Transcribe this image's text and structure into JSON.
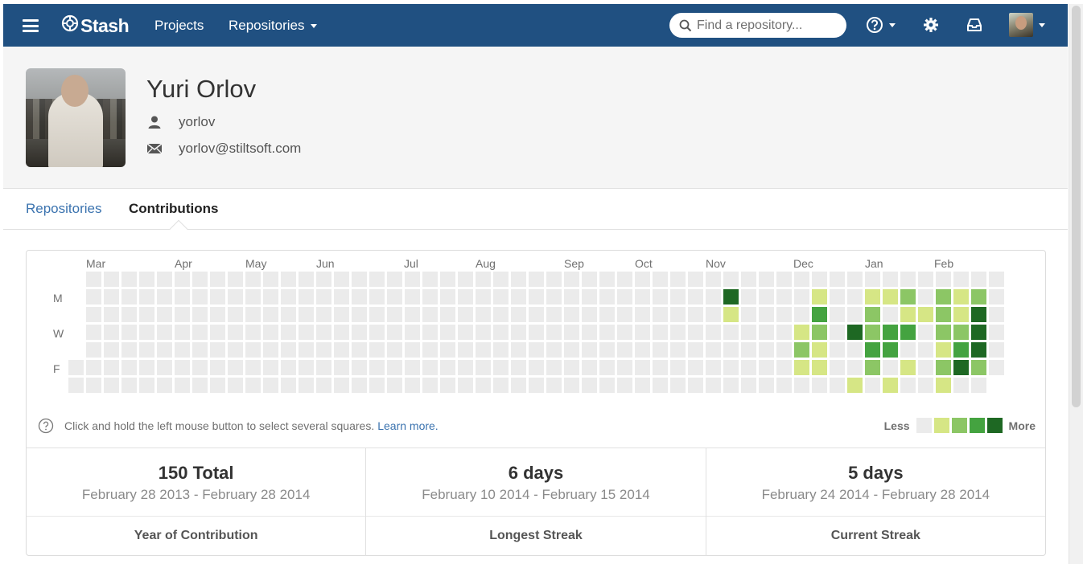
{
  "nav": {
    "logo_text": "Stash",
    "projects_label": "Projects",
    "repositories_label": "Repositories",
    "search_placeholder": "Find a repository...",
    "icons": [
      "menu-icon",
      "stash-logo-icon",
      "search-icon",
      "help-icon",
      "gear-icon",
      "inbox-icon",
      "user-avatar"
    ]
  },
  "profile": {
    "name": "Yuri Orlov",
    "username": "yorlov",
    "email": "yorlov@stiltsoft.com"
  },
  "tabs": [
    {
      "label": "Repositories",
      "active": false
    },
    {
      "label": "Contributions",
      "active": true
    }
  ],
  "calendar": {
    "months": [
      "Mar",
      "Apr",
      "May",
      "Jun",
      "Jul",
      "Aug",
      "Sep",
      "Oct",
      "Nov",
      "Dec",
      "Jan",
      "Feb"
    ],
    "day_labels": [
      "M",
      "W",
      "F"
    ],
    "levels": [
      "#ebebeb",
      "#d6e685",
      "#8cc665",
      "#44a340",
      "#1e6823"
    ],
    "active_cells": [
      {
        "week": 37,
        "day": 1,
        "level": 4
      },
      {
        "week": 37,
        "day": 2,
        "level": 1
      },
      {
        "week": 41,
        "day": 3,
        "level": 1
      },
      {
        "week": 41,
        "day": 4,
        "level": 2
      },
      {
        "week": 41,
        "day": 5,
        "level": 1
      },
      {
        "week": 42,
        "day": 1,
        "level": 1
      },
      {
        "week": 42,
        "day": 2,
        "level": 3
      },
      {
        "week": 42,
        "day": 3,
        "level": 2
      },
      {
        "week": 42,
        "day": 4,
        "level": 1
      },
      {
        "week": 42,
        "day": 5,
        "level": 1
      },
      {
        "week": 44,
        "day": 3,
        "level": 4
      },
      {
        "week": 44,
        "day": 6,
        "level": 1
      },
      {
        "week": 45,
        "day": 1,
        "level": 1
      },
      {
        "week": 45,
        "day": 2,
        "level": 2
      },
      {
        "week": 45,
        "day": 3,
        "level": 2
      },
      {
        "week": 45,
        "day": 4,
        "level": 3
      },
      {
        "week": 45,
        "day": 5,
        "level": 2
      },
      {
        "week": 46,
        "day": 1,
        "level": 1
      },
      {
        "week": 46,
        "day": 3,
        "level": 3
      },
      {
        "week": 46,
        "day": 4,
        "level": 3
      },
      {
        "week": 46,
        "day": 6,
        "level": 1
      },
      {
        "week": 47,
        "day": 1,
        "level": 2
      },
      {
        "week": 47,
        "day": 2,
        "level": 1
      },
      {
        "week": 47,
        "day": 3,
        "level": 3
      },
      {
        "week": 47,
        "day": 5,
        "level": 1
      },
      {
        "week": 48,
        "day": 2,
        "level": 1
      },
      {
        "week": 49,
        "day": 1,
        "level": 2
      },
      {
        "week": 49,
        "day": 2,
        "level": 2
      },
      {
        "week": 49,
        "day": 3,
        "level": 2
      },
      {
        "week": 49,
        "day": 4,
        "level": 1
      },
      {
        "week": 49,
        "day": 5,
        "level": 2
      },
      {
        "week": 49,
        "day": 6,
        "level": 1
      },
      {
        "week": 50,
        "day": 1,
        "level": 1
      },
      {
        "week": 50,
        "day": 2,
        "level": 1
      },
      {
        "week": 50,
        "day": 3,
        "level": 2
      },
      {
        "week": 50,
        "day": 4,
        "level": 3
      },
      {
        "week": 50,
        "day": 5,
        "level": 4
      },
      {
        "week": 51,
        "day": 1,
        "level": 2
      },
      {
        "week": 51,
        "day": 2,
        "level": 4
      },
      {
        "week": 51,
        "day": 3,
        "level": 4
      },
      {
        "week": 51,
        "day": 4,
        "level": 4
      },
      {
        "week": 51,
        "day": 5,
        "level": 2
      }
    ]
  },
  "hint": {
    "text": "Click and hold the left mouse button to select several squares.",
    "link": "Learn more."
  },
  "legend": {
    "less": "Less",
    "more": "More"
  },
  "stats": [
    {
      "value": "150 Total",
      "range": "February 28 2013 - February 28 2014",
      "label": "Year of Contribution"
    },
    {
      "value": "6 days",
      "range": "February 10 2014 - February 15 2014",
      "label": "Longest Streak"
    },
    {
      "value": "5 days",
      "range": "February 24 2014 - February 28 2014",
      "label": "Current Streak"
    }
  ]
}
